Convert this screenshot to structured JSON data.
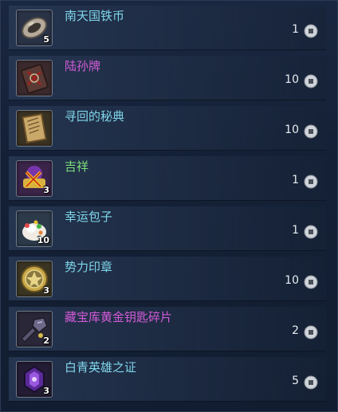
{
  "colors": {
    "name_white": "#7fd6ea",
    "name_purple": "#d45bd8",
    "name_green": "#7ee07a",
    "quantity": "#e8ecf2"
  },
  "items": [
    {
      "name": "南天国铁币",
      "stack": "5",
      "quantity": "1",
      "name_color": "#7fd6ea",
      "icon": "coin-medal-icon"
    },
    {
      "name": "陆孙牌",
      "stack": "",
      "quantity": "10",
      "name_color": "#d45bd8",
      "icon": "red-seal-tablet-icon"
    },
    {
      "name": "寻回的秘典",
      "stack": "",
      "quantity": "10",
      "name_color": "#7fd6ea",
      "icon": "old-book-icon"
    },
    {
      "name": "吉祥",
      "stack": "3",
      "quantity": "1",
      "name_color": "#7ee07a",
      "icon": "lucky-charm-icon"
    },
    {
      "name": "幸运包子",
      "stack": "10",
      "quantity": "1",
      "name_color": "#7fd6ea",
      "icon": "steamed-bun-icon"
    },
    {
      "name": "势力印章",
      "stack": "3",
      "quantity": "10",
      "name_color": "#7fd6ea",
      "icon": "faction-seal-icon"
    },
    {
      "name": "藏宝库黄金钥匙碎片",
      "stack": "2",
      "quantity": "2",
      "name_color": "#d45bd8",
      "icon": "key-fragment-icon"
    },
    {
      "name": "白青英雄之证",
      "stack": "3",
      "quantity": "5",
      "name_color": "#7fd6ea",
      "icon": "hero-proof-icon"
    }
  ]
}
